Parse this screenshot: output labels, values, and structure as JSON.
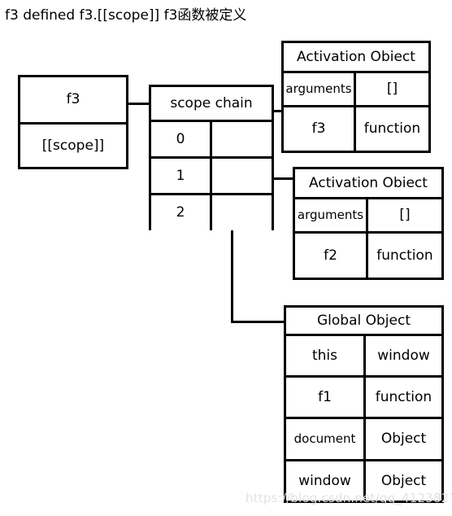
{
  "title": "f3 defined f3.[[scope]] f3函数被定义",
  "watermark": "https://blog.csdn.net/qq_41238274",
  "colors": {
    "stroke": "#000000",
    "background": "#ffffff",
    "watermark": "#e3e3e3"
  },
  "function_box": {
    "name": "f3-function-box",
    "rows": [
      {
        "label": "f3"
      },
      {
        "label": "[[scope]]"
      }
    ]
  },
  "scope_chain": {
    "header": "scope chain",
    "rows": [
      {
        "index": "0",
        "value": ""
      },
      {
        "index": "1",
        "value": ""
      },
      {
        "index": "2",
        "value": ""
      }
    ]
  },
  "activation_object_1": {
    "header": "Activation Obiect",
    "rows": [
      {
        "key": "arguments",
        "value": "[]"
      },
      {
        "key": "f3",
        "value": "function"
      }
    ]
  },
  "activation_object_2": {
    "header": "Activation Obiect",
    "rows": [
      {
        "key": "arguments",
        "value": "[]"
      },
      {
        "key": "f2",
        "value": "function"
      }
    ]
  },
  "global_object": {
    "header": "Global Object",
    "rows": [
      {
        "key": "this",
        "value": "window"
      },
      {
        "key": "f1",
        "value": "function"
      },
      {
        "key": "document",
        "value": "Object"
      },
      {
        "key": "window",
        "value": "Object"
      }
    ]
  }
}
